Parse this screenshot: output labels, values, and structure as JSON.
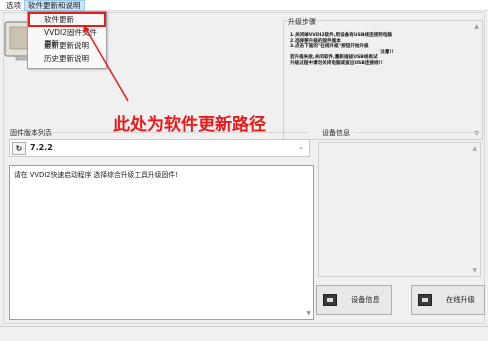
{
  "menubar": {
    "items": [
      "选项",
      "软件更新和说明"
    ]
  },
  "dropdown": {
    "items": [
      "软件更新",
      "VVDI2固件文件更新",
      "最新更新说明",
      "历史更新说明"
    ]
  },
  "upgrade_steps": {
    "title": "升级步骤",
    "lines": [
      "1.关闭掉VVDI2软件,用设备有USB线连接到电脑",
      "2.选择要升级的固件版本",
      "3.点击下面的\"在线升级\"按钮开始升级",
      "注意!!",
      "若升级失败,关闭软件,重新插拔USB线再试",
      "升级过程中请勿关闭电脑或拔出USB连接线!!"
    ]
  },
  "annotation": {
    "text": "此处为软件更新路径"
  },
  "firmware": {
    "label": "固件版本列表",
    "version": "7.2.2",
    "log": "请在 VVDI2快速启动程序 选择综合升级工具升级固件!"
  },
  "device": {
    "label": "设备信息"
  },
  "buttons": {
    "device_info": "设备信息",
    "online_upgrade": "在线升级"
  },
  "colors": {
    "annotation": "#e81a1a",
    "highlight_border": "#e02020"
  },
  "icons": [
    "refresh-icon",
    "device-info-icon",
    "online-upgrade-icon",
    "dropdown-caret-icon"
  ]
}
